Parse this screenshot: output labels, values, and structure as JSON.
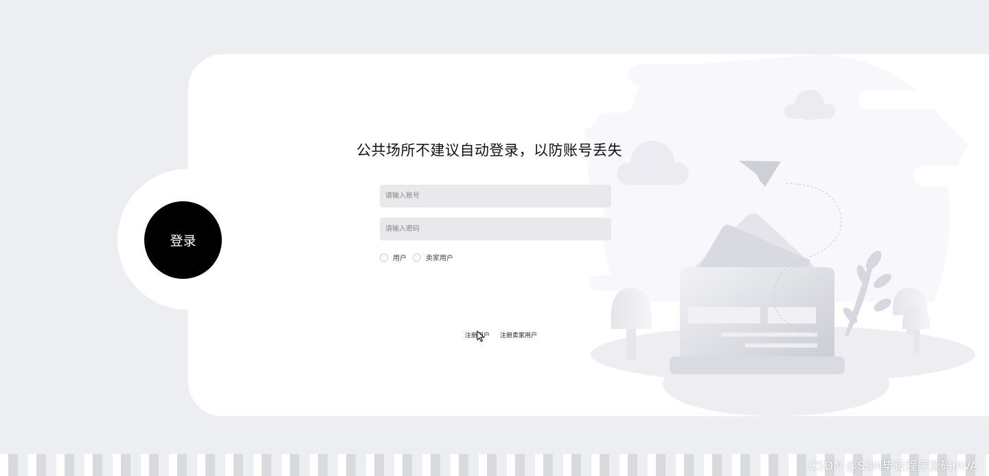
{
  "login": {
    "circle_label": "登录",
    "title": "公共场所不建议自动登录，以防账号丢失",
    "account_placeholder": "请输入账号",
    "password_placeholder": "请输入密码",
    "roles": [
      "用户",
      "卖家用户"
    ],
    "register_user": "注册用户",
    "register_seller": "注册卖家用户"
  },
  "watermark": "CSDN @SSM毕设程序源码JAVA",
  "colors": {
    "background": "#edeef1",
    "card": "#ffffff",
    "field": "#e9e8ea",
    "accent": "#000000"
  }
}
